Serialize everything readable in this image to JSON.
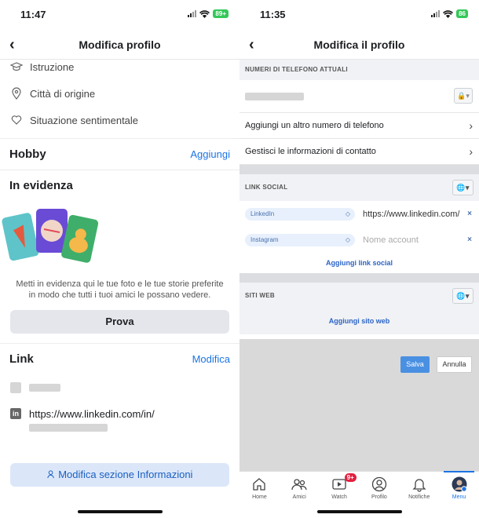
{
  "left": {
    "status_time": "11:47",
    "battery": "89+",
    "nav_title": "Modifica profilo",
    "info_rows": [
      {
        "label": "Istruzione",
        "icon": "graduation-cap-icon"
      },
      {
        "label": "Città di origine",
        "icon": "location-pin-icon"
      },
      {
        "label": "Situazione sentimentale",
        "icon": "heart-icon"
      }
    ],
    "hobby": {
      "title": "Hobby",
      "action": "Aggiungi"
    },
    "featured": {
      "title": "In evidenza",
      "description": "Metti in evidenza qui le tue foto e le tue storie preferite in modo che tutti i tuoi amici le possano vedere.",
      "button": "Prova"
    },
    "link": {
      "title": "Link",
      "action": "Modifica",
      "linkedin_url": "https://www.linkedin.com/in/"
    },
    "edit_info_button": "Modifica sezione Informazioni"
  },
  "right": {
    "status_time": "11:35",
    "battery": "86",
    "nav_title": "Modifica il profilo",
    "phones_header": "NUMERI DI TELEFONO ATTUALI",
    "add_phone": "Aggiungi un altro numero di telefono",
    "manage_contacts": "Gestisci le informazioni di contatto",
    "social_header": "LINK SOCIAL",
    "social_links": [
      {
        "network": "LinkedIn",
        "value": "https://www.linkedin.com/",
        "placeholder": ""
      },
      {
        "network": "Instagram",
        "value": "",
        "placeholder": "Nome account"
      }
    ],
    "add_social": "Aggiungi link social",
    "websites_header": "SITI WEB",
    "add_website": "Aggiungi sito web",
    "save_button": "Salva",
    "cancel_button": "Annulla",
    "tabs": [
      {
        "label": "Home",
        "icon": "home-icon"
      },
      {
        "label": "Amici",
        "icon": "friends-icon"
      },
      {
        "label": "Watch",
        "icon": "watch-icon",
        "badge": "9+"
      },
      {
        "label": "Profilo",
        "icon": "profile-icon"
      },
      {
        "label": "Notifiche",
        "icon": "bell-icon"
      },
      {
        "label": "Menu",
        "icon": "avatar-icon",
        "active": true
      }
    ]
  }
}
